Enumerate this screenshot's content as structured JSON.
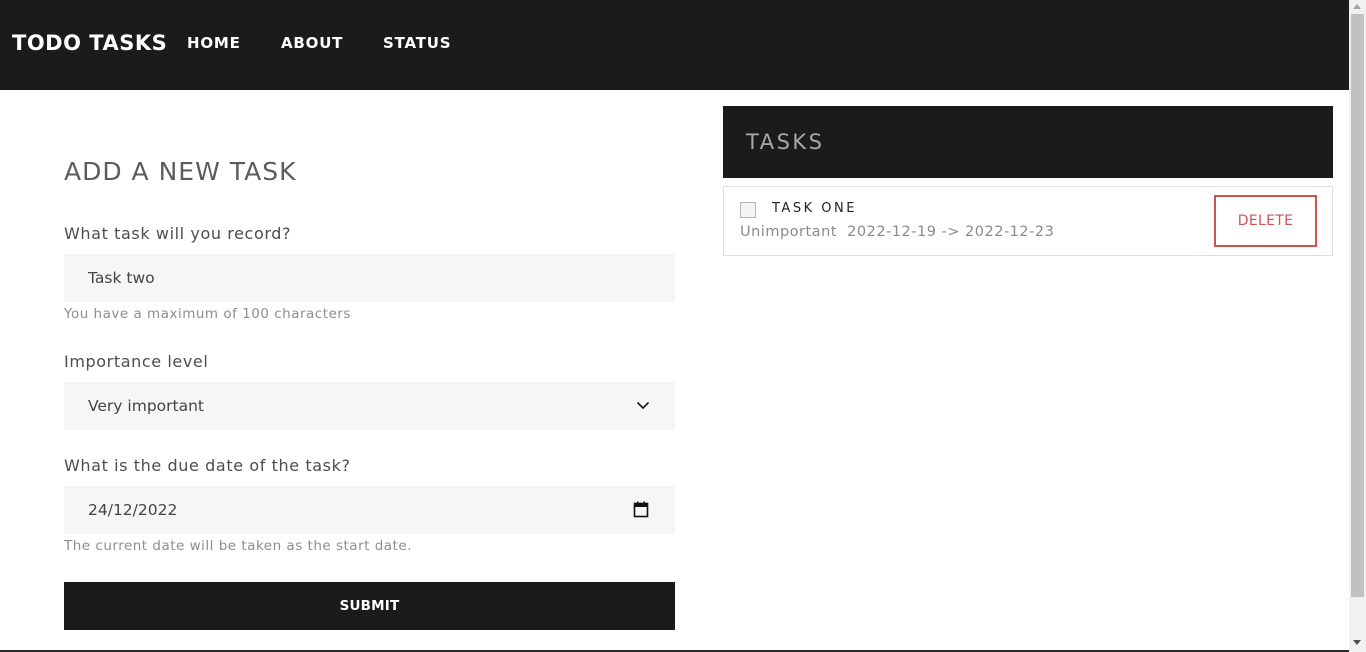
{
  "navbar": {
    "brand": "TODO TASKS",
    "links": [
      "HOME",
      "ABOUT",
      "STATUS"
    ]
  },
  "form": {
    "title": "ADD A NEW TASK",
    "task_label": "What task will you record?",
    "task_value": "Task two",
    "task_help": "You have a maximum of 100 characters",
    "importance_label": "Importance level",
    "importance_value": "Very important",
    "date_label": "What is the due date of the task?",
    "date_value": "24/12/2022",
    "date_help": "The current date will be taken as the start date.",
    "submit_label": "SUBMIT"
  },
  "tasks": {
    "title": "TASKS",
    "items": [
      {
        "name": "TASK ONE",
        "importance": "Unimportant",
        "range": "2022-12-19 -> 2022-12-23",
        "checked": false,
        "delete_label": "DELETE"
      }
    ]
  },
  "icons": {
    "select": "chevron-down-icon",
    "date": "calendar-icon"
  },
  "colors": {
    "dark": "#1b1b1b",
    "field_bg": "#f6f6f7",
    "delete_red": "#d05252"
  }
}
